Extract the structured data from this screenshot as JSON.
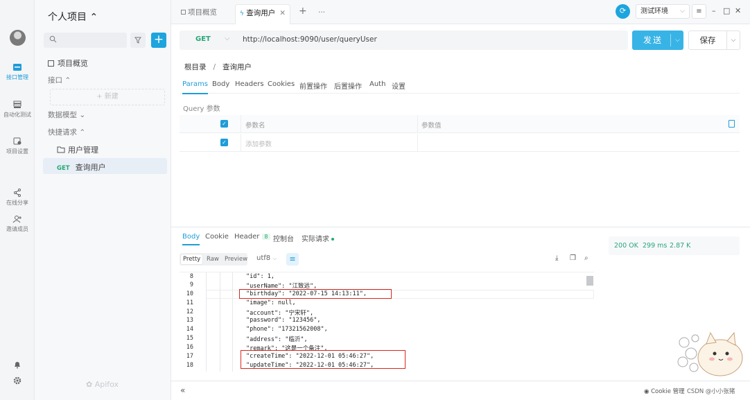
{
  "rail": {
    "items": [
      {
        "label": "接口管理",
        "icon": "interface-icon",
        "active": true
      },
      {
        "label": "自动化测试",
        "icon": "automation-icon",
        "active": false
      },
      {
        "label": "项目设置",
        "icon": "settings-icon",
        "active": false
      },
      {
        "label": "在线分享",
        "icon": "share-icon",
        "active": false
      },
      {
        "label": "邀请成员",
        "icon": "invite-icon",
        "active": false
      }
    ]
  },
  "sidebar": {
    "project_title": "个人项目 ⌃",
    "search_placeholder": "",
    "overview": "项目概览",
    "interfaces": "接口 ⌃",
    "new_label": "+ 新建",
    "data_models": "数据模型 ⌄",
    "quick_requests": "快捷请求 ⌃",
    "folder": "用户管理",
    "active_request_method": "GET",
    "active_request_name": "查询用户",
    "brand": "Apifox"
  },
  "topbar": {
    "tabs": [
      {
        "label": "项目概览",
        "active": false
      },
      {
        "label": "查询用户",
        "active": true
      }
    ],
    "add_tab": "+",
    "more_tabs": "···",
    "environment": "测试环境",
    "window_controls": {
      "minimize": "–",
      "maximize": "□",
      "close": "✕"
    }
  },
  "request": {
    "method": "GET",
    "url": "http://localhost:9090/user/queryUser",
    "send_label": "发送",
    "save_label": "保存",
    "breadcrumb": {
      "root": "根目录",
      "current": "查询用户"
    },
    "tabs": [
      "Params",
      "Body",
      "Headers",
      "Cookies",
      "前置操作",
      "后置操作",
      "Auth",
      "设置"
    ],
    "active_tab": "Params",
    "query_label": "Query 参数",
    "param_headers": {
      "name": "参数名",
      "value": "参数值"
    },
    "add_param_placeholder": "添加参数"
  },
  "response": {
    "tabs": [
      {
        "label": "Body",
        "active": true
      },
      {
        "label": "Cookie",
        "active": false
      },
      {
        "label": "Header",
        "badge": "8",
        "active": false
      },
      {
        "label": "控制台",
        "active": false
      },
      {
        "label": "实际请求",
        "dot": true,
        "active": false
      }
    ],
    "formats": [
      "Pretty",
      "Raw",
      "Preview"
    ],
    "active_format": "Pretty",
    "charset": "utf8",
    "status": "200 OK",
    "time": "299 ms",
    "size": "2.87 K",
    "code_lines": [
      {
        "num": "8",
        "text": "\"id\": 1,"
      },
      {
        "num": "9",
        "text": "\"userName\": \"江致远\","
      },
      {
        "num": "10",
        "text": "\"birthday\": \"2022-07-15 14:13:11\","
      },
      {
        "num": "11",
        "text": "\"image\": null,"
      },
      {
        "num": "12",
        "text": "\"account\": \"宁宋轩\","
      },
      {
        "num": "13",
        "text": "\"password\": \"123456\","
      },
      {
        "num": "14",
        "text": "\"phone\": \"17321562008\","
      },
      {
        "num": "15",
        "text": "\"address\": \"临沂\","
      },
      {
        "num": "16",
        "text": "\"remark\": \"这是一个备注\","
      },
      {
        "num": "17",
        "text": "\"createTime\": \"2022-12-01 05:46:27\","
      },
      {
        "num": "18",
        "text": "\"updateTime\": \"2022-12-01 05:46:27\","
      }
    ]
  },
  "statusbar": {
    "collapse": "«",
    "cookie_manager": "Cookie 管理",
    "watermark": "CSDN @小小张猪"
  },
  "colors": {
    "accent": "#1e9dd8",
    "get": "#27a775",
    "highlight": "#d9261c"
  }
}
